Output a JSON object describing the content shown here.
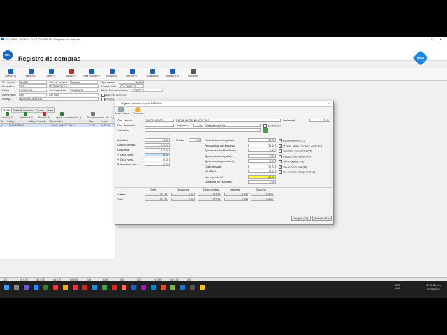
{
  "window": {
    "title": "SOLIVOS · MÓDULO DE COMPRAS · Registro de compras",
    "min": "—",
    "max": "☐",
    "close": "✕"
  },
  "header": {
    "title": "Registro de compras",
    "logo_text": "REG",
    "brand_text": "Dana"
  },
  "toolbar": [
    {
      "label": "Nuevo(F1)",
      "color": "#1565c0"
    },
    {
      "label": "Salvar(F2)",
      "color": "#1565c0"
    },
    {
      "label": "Abrir(F3)",
      "color": "#1565c0"
    },
    {
      "label": "Borrar(F4)",
      "color": "#c62828"
    },
    {
      "label": "Nota crédito(F5)",
      "color": "#1565c0"
    },
    {
      "label": "Limpiar(F6)",
      "color": "#1565c0"
    },
    {
      "label": "Imprimir(F7)",
      "color": "#1565c0"
    },
    {
      "label": "Finalización",
      "color": "#1565c0"
    },
    {
      "label": "Ordenes (F10)",
      "color": "#1565c0"
    },
    {
      "label": "Opciones",
      "color": "#555555"
    }
  ],
  "form": {
    "factura_label": "Nº Factura:",
    "factura": "104587",
    "tipo_label": "Tipo de compra:",
    "tipo": "Nacional",
    "tipo_cambio_label": "Tipo cambio:",
    "tipo_cambio": "560.00",
    "proveedor_label": "Proveedor:",
    "proveedor_code": "025",
    "proveedor_name": "DOSPINOS S.A.",
    "moneda_label": "Moneda CxP:",
    "moneda": "COL ONES CR",
    "fecha_label": "Fecha:",
    "fecha": "27/05/2022",
    "fecha_recibido_label": "Fecha recibido:",
    "fecha_recibido": "27/05/2022",
    "fecha_doc_label": "Fecha físico documento:",
    "fecha_doc": "27/05/2022",
    "forma_pago_label": "Forma pago:",
    "forma_pago_code": "030",
    "forma_pago": "30 DIAS",
    "bodega_label": "Bodega:",
    "bodega": "BODEGA GENERAL",
    "aplicado_label": "Aplicado inventario",
    "finaliza_label": "Finaliza"
  },
  "tabs": [
    "Detalle",
    "Totales",
    "Auditoría",
    "Precios",
    "Notas"
  ],
  "grid_toolbar": [
    "Insertar(F9)",
    "Modificar(F9)",
    "Borrar(F10)",
    "Aplicar inventario (ctrl + I)",
    "Retirar inventario (ctrl + O)"
  ],
  "grid": {
    "headers": [
      "N.",
      "Código",
      "Código Proveedor",
      "Descripción",
      "Cant.",
      "Precio"
    ],
    "rows": [
      {
        "n": "1",
        "codigo": "7.744108455610",
        "codprov": "",
        "desc": "LECHE HOMOG. 2% 1 L",
        "cant": "10.00",
        "precio": "2,412.00"
      }
    ]
  },
  "status": [
    "0.00",
    "2d: 0.00",
    "3d: 0.00",
    "4d: 0.00",
    "5d: 0.00",
    "0.00",
    "0.00",
    "0.00",
    "0.00",
    "2d: 0.00",
    "3d: 0.00",
    "0.00"
  ],
  "dialog": {
    "title": "Registro rápido de líneas - DEMO 01",
    "close": "✕",
    "tabs": [
      "Nueva línea",
      "Opciones"
    ],
    "cod_articulo_label": "Cód. Artículo:",
    "cod_articulo": "7441081815610",
    "descripcion": "LECHE PASTEURIZADA 2% 1 L",
    "existencias_label": "Existencias:",
    "existencias": "28.00",
    "cod_proveedor_label": "Cód. Proveedor:",
    "impuesto_label": "Impuesto:",
    "impuesto": "1.00",
    "tarifa": "Tarifa reducida 1%",
    "bonificacion_label": "Bonificación",
    "ubicacion_label": "Ubicación:",
    "left": [
      {
        "label": "Cantidad:",
        "value": "1.00"
      },
      {
        "label": "Costo ordenado:",
        "value": "727.72"
      },
      {
        "label": "Costo total:",
        "value": "727.72"
      },
      {
        "label": "% Desc. costo:",
        "value": "0.00"
      },
      {
        "label": "% Desc. venta:",
        "value": "0.00"
      },
      {
        "label": "Rubros extra imp.:",
        "value": "0.00"
      }
    ],
    "unidad_label": "Unidad:",
    "unidad": "1.00",
    "middle": [
      {
        "label": "Precio actual sin impuesto:",
        "value": "727.72"
      },
      {
        "label": "Precio actual con impuesto:",
        "value": "735.00"
      },
      {
        "label": "Ajuste costo bonificaciones(-):",
        "value": "0.00"
      },
      {
        "label": "Ajuste costo transporte(+):",
        "value": "0.00"
      },
      {
        "label": "Ajuste costo importación(+):",
        "value": "0.00"
      },
      {
        "label": "Costo ajustado:",
        "value": "727.72"
      },
      {
        "label": "% Utilidad:",
        "value": "13.43"
      },
      {
        "label": "Nuevo precio IVI:",
        "value": "831.65"
      },
      {
        "label": "Diferencia por redondeo:",
        "value": "0.00"
      }
    ],
    "options": [
      {
        "label": "Actualiza precio (F1)",
        "checked": true
      },
      {
        "label": "% Desc. venta = % Desc. costo (F2)",
        "checked": true
      },
      {
        "label": "Actualizar descuentos (F3)",
        "checked": false
      },
      {
        "label": "Categoría de precios (F4)",
        "checked": false
      },
      {
        "label": "Tab en precios (F5)",
        "checked": true
      },
      {
        "label": "Tab en costo total (F6)",
        "checked": true
      },
      {
        "label": "Tab en costo transporte (F12)",
        "checked": true
      }
    ],
    "summary_headers": [
      "Costo",
      "Descuentos",
      "Costo con desc.",
      "Impuestos",
      "Costo IVI"
    ],
    "summary_rows": [
      {
        "label": "Unitario",
        "values": [
          "727.72",
          "0.00",
          "727.72",
          "7.28",
          "735.00"
        ]
      },
      {
        "label": "Total",
        "values": [
          "727.72",
          "0.00",
          "727.72",
          "7.28",
          "735.00"
        ]
      }
    ],
    "accept": "Aceptar (F8)",
    "cancel": "Cancelar (Esc)"
  },
  "taskbar": {
    "lang": "ESP\nLAA",
    "time": "02:47:16 p.m.",
    "date": "27/05/2022"
  }
}
